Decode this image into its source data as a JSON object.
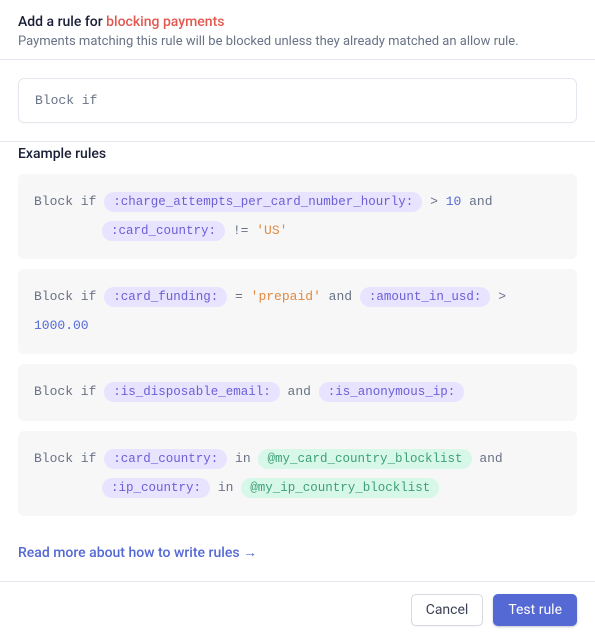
{
  "header": {
    "title_prefix": "Add a rule for ",
    "title_emph": "blocking payments",
    "subtitle": "Payments matching this rule will be blocked unless they already matched an allow rule."
  },
  "input": {
    "value": "Block if"
  },
  "examples_title": "Example rules",
  "examples": [
    {
      "lines": [
        [
          {
            "t": "kw",
            "v": "Block if  "
          },
          {
            "t": "var",
            "v": ":charge_attempts_per_card_number_hourly:"
          },
          {
            "t": "op",
            "v": "  > "
          },
          {
            "t": "num",
            "v": "10"
          },
          {
            "t": "kw",
            "v": " and"
          }
        ],
        [
          {
            "t": "indent",
            "v": ""
          },
          {
            "t": "var",
            "v": ":card_country:"
          },
          {
            "t": "op",
            "v": "  != "
          },
          {
            "t": "str",
            "v": "'US'"
          }
        ]
      ]
    },
    {
      "lines": [
        [
          {
            "t": "kw",
            "v": "Block if  "
          },
          {
            "t": "var",
            "v": ":card_funding:"
          },
          {
            "t": "op",
            "v": "  = "
          },
          {
            "t": "str",
            "v": "'prepaid'"
          },
          {
            "t": "kw",
            "v": " and  "
          },
          {
            "t": "var",
            "v": ":amount_in_usd:"
          },
          {
            "t": "op",
            "v": "  > "
          },
          {
            "t": "num",
            "v": "1000.00"
          }
        ]
      ]
    },
    {
      "lines": [
        [
          {
            "t": "kw",
            "v": "Block if  "
          },
          {
            "t": "var",
            "v": ":is_disposable_email:"
          },
          {
            "t": "kw",
            "v": "  and  "
          },
          {
            "t": "var",
            "v": ":is_anonymous_ip:"
          }
        ]
      ]
    },
    {
      "lines": [
        [
          {
            "t": "kw",
            "v": "Block if  "
          },
          {
            "t": "var",
            "v": ":card_country:"
          },
          {
            "t": "kw",
            "v": "  in  "
          },
          {
            "t": "at",
            "v": "@my_card_country_blocklist"
          },
          {
            "t": "kw",
            "v": "  and"
          }
        ],
        [
          {
            "t": "indent",
            "v": ""
          },
          {
            "t": "var",
            "v": ":ip_country:"
          },
          {
            "t": "kw",
            "v": "  in  "
          },
          {
            "t": "at",
            "v": "@my_ip_country_blocklist"
          }
        ]
      ]
    }
  ],
  "link_text": "Read more about how to write rules",
  "link_arrow": "→",
  "footer": {
    "cancel": "Cancel",
    "test": "Test rule"
  }
}
